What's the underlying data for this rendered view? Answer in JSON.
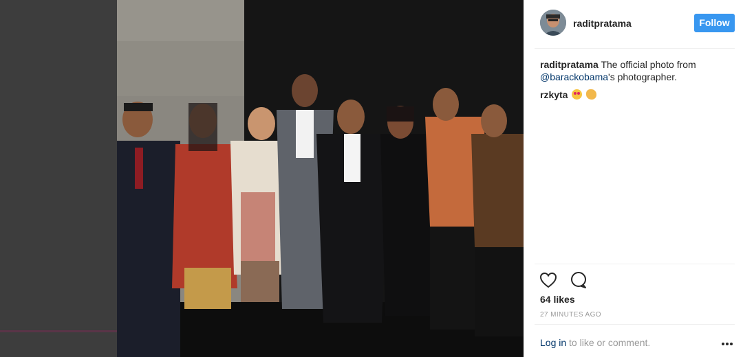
{
  "post": {
    "username": "raditpratama",
    "follow_label": "Follow",
    "caption": {
      "author": "raditpratama",
      "text_before": " The official photo from ",
      "mention": "@barackobama",
      "text_after": "'s photographer."
    },
    "comments": [
      {
        "author": "rzkyta",
        "emojis": [
          "heart-eyes-emoji",
          "clapping-hands-emoji"
        ]
      }
    ],
    "likes": "64 likes",
    "timestamp": "27 MINUTES AGO",
    "login_link": "Log in",
    "login_suffix": " to like or comment."
  },
  "colors": {
    "follow_button": "#3897f0",
    "link": "#003569",
    "muted": "#999999",
    "left_gutter": "#3d3d3d"
  }
}
